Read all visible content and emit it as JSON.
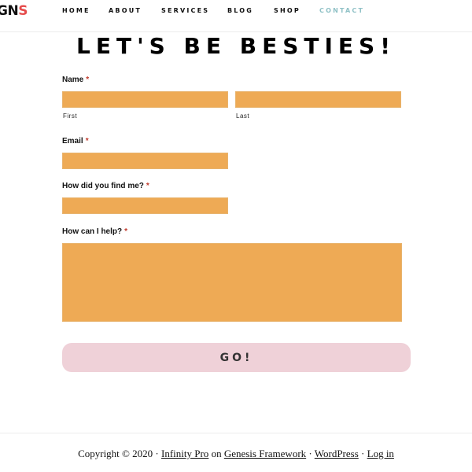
{
  "header": {
    "logo_text": "GN",
    "logo_accent": "S",
    "nav": [
      {
        "label": "HOME"
      },
      {
        "label": "ABOUT"
      },
      {
        "label": "SERVICES"
      },
      {
        "label": "BLOG"
      },
      {
        "label": "SHOP"
      },
      {
        "label": "CONTACT",
        "active": true
      }
    ]
  },
  "title": "LET'S BE BESTIES!",
  "form": {
    "name": {
      "label": "Name",
      "required_mark": "*",
      "first_sublabel": "First",
      "last_sublabel": "Last",
      "first_value": "",
      "last_value": ""
    },
    "email": {
      "label": "Email",
      "required_mark": "*",
      "value": ""
    },
    "how_found": {
      "label": "How did you find me?",
      "required_mark": "*",
      "value": ""
    },
    "help": {
      "label": "How can I help?",
      "required_mark": "*",
      "value": ""
    },
    "submit_label": "GO!"
  },
  "footer": {
    "copyright": "Copyright © 2020 ·",
    "theme_link": "Infinity Pro",
    "on": "on",
    "framework_link": "Genesis Framework",
    "sep1": "·",
    "wp_link": "WordPress",
    "sep2": "·",
    "login_link": "Log in"
  },
  "colors": {
    "field_fill": "#eeaa55",
    "button_fill": "#efd1d8",
    "nav_active": "#8fc1c6",
    "required": "#c0392b"
  }
}
